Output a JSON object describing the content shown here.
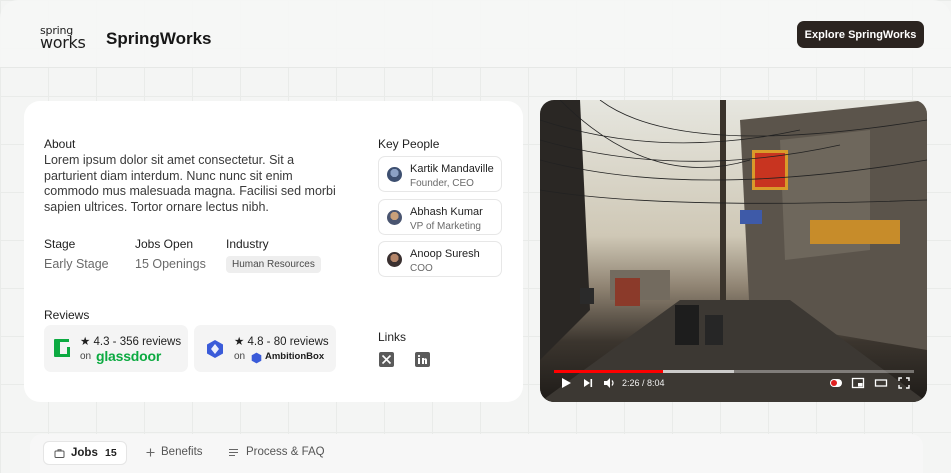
{
  "header": {
    "logo_line1": "spring",
    "logo_line2": "works",
    "brand_name": "SpringWorks",
    "cta_label": "Explore SpringWorks"
  },
  "about": {
    "title": "About",
    "text": "Lorem ipsum dolor sit amet consectetur. Sit a parturient diam interdum. Nunc nunc sit enim commodo mus malesuada magna. Facilisi sed morbi sapien ultrices. Tortor ornare lectus nibh."
  },
  "details": {
    "stage_label": "Stage",
    "stage_value": "Early Stage",
    "jobs_label": "Jobs Open",
    "jobs_value": "15 Openings",
    "industry_label": "Industry",
    "industry_value": "Human Resources"
  },
  "reviews": {
    "title": "Reviews",
    "glassdoor": {
      "rating": "★ 4.3 - 356 reviews",
      "on": "on",
      "name": "glassdoor",
      "color": "#0caa41"
    },
    "ambitionbox": {
      "rating": "★ 4.8 - 80 reviews",
      "on": "on",
      "name": "AmbitionBox",
      "color": "#3a5bd9"
    }
  },
  "key_people": {
    "title": "Key People",
    "people": [
      {
        "name": "Kartik Mandaville",
        "role": "Founder, CEO"
      },
      {
        "name": "Abhash Kumar",
        "role": "VP of Marketing"
      },
      {
        "name": "Anoop Suresh",
        "role": "COO"
      }
    ]
  },
  "links": {
    "title": "Links",
    "icons": [
      "x-twitter-icon",
      "linkedin-icon"
    ]
  },
  "video": {
    "time": "2:26 / 8:04",
    "progress_fraction": 0.302,
    "buffer_fraction": 0.5,
    "progress_color": "#ff0000"
  },
  "tabs": {
    "items": [
      {
        "label": "Jobs",
        "count": "15",
        "icon": "briefcase-icon",
        "active": true
      },
      {
        "label": "Benefits",
        "icon": "plus-icon",
        "active": false
      },
      {
        "label": "Process & FAQ",
        "icon": "list-icon",
        "active": false
      }
    ]
  }
}
